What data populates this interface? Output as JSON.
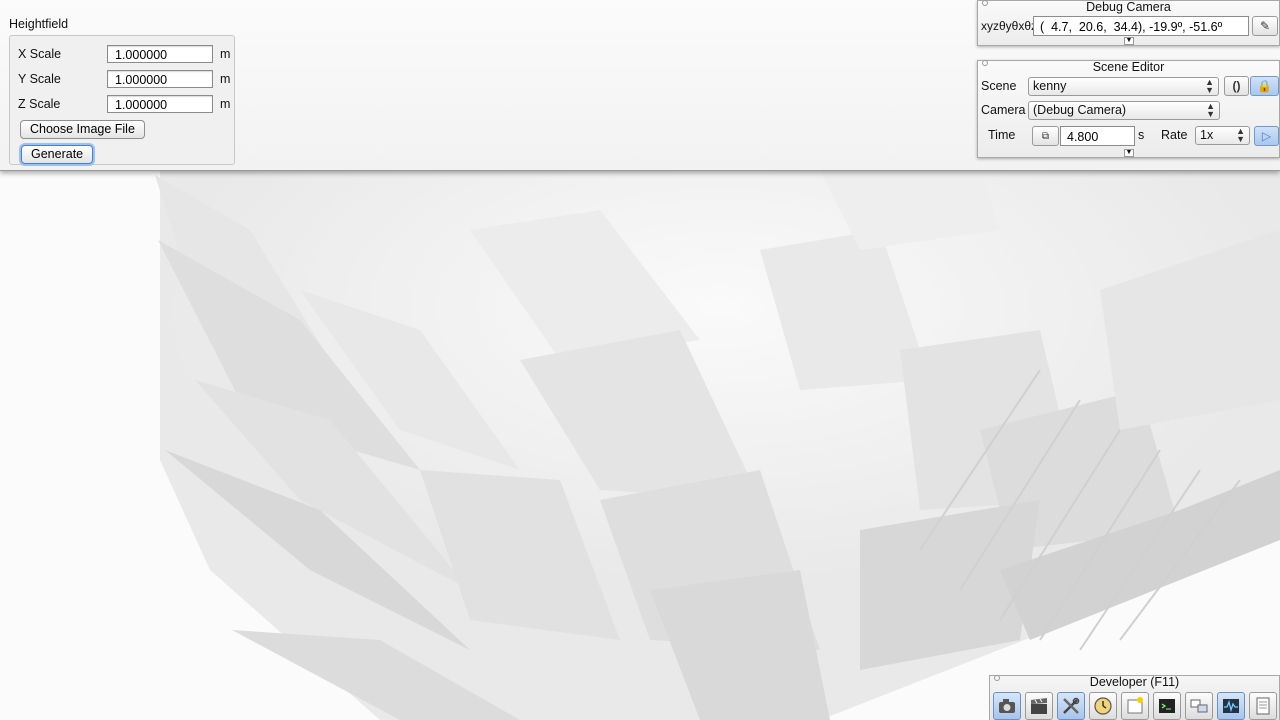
{
  "heightfield": {
    "title": "Heightfield",
    "rows": [
      {
        "label": "X Scale",
        "value": "1.000000",
        "unit": "m"
      },
      {
        "label": "Y Scale",
        "value": "1.000000",
        "unit": "m"
      },
      {
        "label": "Z Scale",
        "value": "1.000000",
        "unit": "m"
      }
    ],
    "choose_image_label": "Choose Image File",
    "generate_label": "Generate"
  },
  "debug_camera": {
    "title": "Debug Camera",
    "prefix": "xyzθyθxθz",
    "value": "(  4.7,  20.6,  34.4), -19.9º, -51.6º"
  },
  "scene_editor": {
    "title": "Scene Editor",
    "scene_label": "Scene",
    "scene_value": "kenny",
    "camera_label": "Camera",
    "camera_value": "(Debug Camera)",
    "time_label": "Time",
    "time_value": "4.800",
    "time_unit": "s",
    "rate_label": "Rate",
    "rate_value": "1x"
  },
  "developer": {
    "title": "Developer (F11)",
    "tools": [
      "camera-icon",
      "clapperboard-icon",
      "tools-icon",
      "clock-icon",
      "note-icon",
      "terminal-icon",
      "windows-icon",
      "waveform-icon",
      "document-icon"
    ]
  },
  "colors": {
    "accent": "#4a7fc3",
    "active_button": "#a9c8ee"
  }
}
